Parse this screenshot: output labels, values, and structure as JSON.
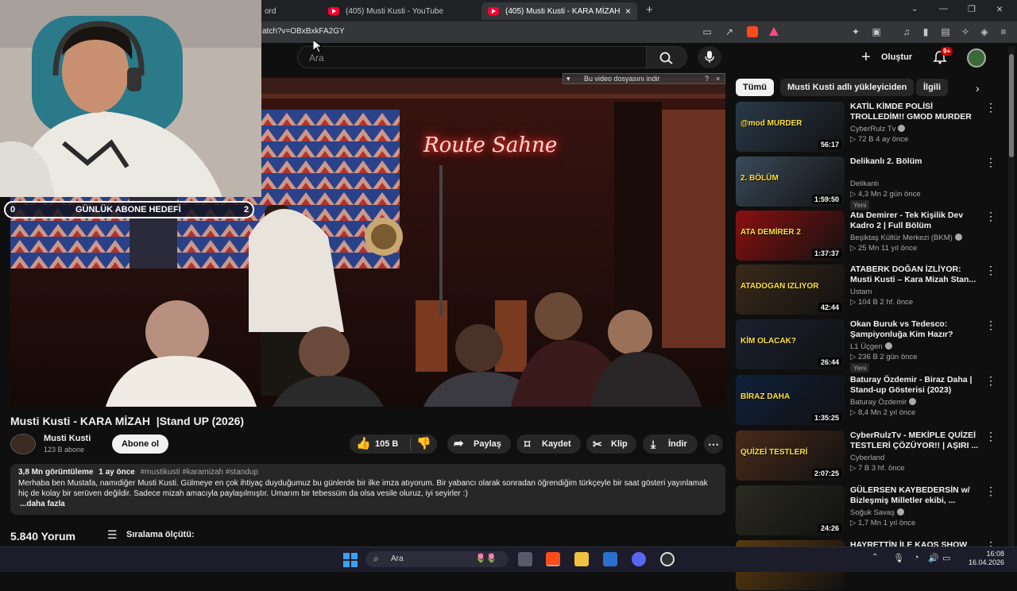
{
  "browser": {
    "tabs": [
      {
        "label": "ord"
      },
      {
        "label": "(405) Musti Kusti - YouTube"
      },
      {
        "label": "(405) Musti Kusti - KARA MİZAH"
      }
    ],
    "new_tab": "+",
    "url": "atch?v=OBxBxkFA2GY"
  },
  "header": {
    "search_placeholder": "Ara",
    "create_label": "Oluştur",
    "notif_count": "9+"
  },
  "download_banner": "Bu video dosyasını indir",
  "download_banner_q": "?",
  "download_banner_close": "×",
  "overlay": {
    "goal_label": "GÜNLÜK ABONE HEDEFİ",
    "goal_current": "0",
    "goal_target": "2"
  },
  "video": {
    "neon_sign": "Route Sahne",
    "title": "Musti Kusti - KARA MİZAH  |Stand UP (2026)",
    "channel": "Musti Kusti",
    "subscribers": "123 B abone",
    "subscribe_label": "Abone ol",
    "likes": "105 B",
    "share_label": "Paylaş",
    "save_label": "Kaydet",
    "clip_label": "Klip",
    "download_label": "İndir"
  },
  "description": {
    "views": "3,8 Mn görüntüleme",
    "date": "1 ay önce",
    "tags": "#mustikusti #karamizah #standup",
    "text": "Merhaba ben Mustafa, namıdiğer Musti Kusti. Gülmeye en çok ihtiyaç duyduğumuz bu günlerde bir ilke imza atıyorum. Bir yabancı olarak sonradan öğrendiğim türkçeyle bir saat gösteri yayınlamak hiç de kolay bir serüven değildir. Sadece mizah amacıyla paylaşılmıştır. Umarım bir tebessüm da olsa vesile oluruz, iyi seyirler :)",
    "more": "...daha fazla"
  },
  "comments": {
    "count": "5.840 Yorum",
    "sort_label": "Sıralama ölçütü:"
  },
  "chips": [
    {
      "label": "Tümü"
    },
    {
      "label": "Musti Kusti adlı yükleyiciden"
    },
    {
      "label": "İlgili"
    }
  ],
  "recommendations": [
    {
      "title": "KATİL KİMDE POLİSİ TROLLEDİM!! GMOD MURDER",
      "channel": "CyberRulz Tv",
      "verified": true,
      "meta": "72 B  4 ay önce",
      "duration": "56:17",
      "badge": "",
      "thumb_text": "@mod MURDER",
      "color": "#2a3a4a"
    },
    {
      "title": "Delikanlı 2. Bölüm",
      "channel": "Delikanlı",
      "verified": false,
      "meta": "4,3 Mn  2 gün önce",
      "duration": "1:59:50",
      "badge": "Yeni",
      "thumb_text": "2. BÖLÜM",
      "color": "#3a4a5a"
    },
    {
      "title": "Ata Demirer - Tek Kişilik Dev Kadro 2 | Full Bölüm",
      "channel": "Beşiktaş Kültür Merkezi (BKM)",
      "verified": true,
      "meta": "25 Mn  11 yıl önce",
      "duration": "1:37:37",
      "badge": "",
      "thumb_text": "ATA DEMİRER 2",
      "color": "#8a1010"
    },
    {
      "title": "ATABERK DOĞAN İZLİYOR: Musti Kusti – Kara Mizah Stan...",
      "channel": "Ustam",
      "verified": false,
      "meta": "104 B  2 hf. önce",
      "duration": "42:44",
      "badge": "",
      "thumb_text": "ATADOGAN IZLIYOR",
      "color": "#3a2a1a"
    },
    {
      "title": "Okan Buruk vs Tedesco: Şampiyonluğa Kim Hazır?",
      "channel": "L1 Üçgen",
      "verified": true,
      "meta": "236 B  2 gün önce",
      "duration": "26:44",
      "badge": "Yeni",
      "thumb_text": "KİM OLACAK?",
      "color": "#1a2030"
    },
    {
      "title": "Baturay Özdemir - Biraz Daha | Stand-up Gösterisi (2023)",
      "channel": "Baturay Özdemir",
      "verified": true,
      "meta": "8,4 Mn  2 yıl önce",
      "duration": "1:35:25",
      "badge": "",
      "thumb_text": "BİRAZ DAHA",
      "color": "#10203a"
    },
    {
      "title": "CyberRulzTv - MEKİPLE QUİZEİ TESTLERİ ÇÖZÜYOR!! | AŞIRI ...",
      "channel": "Cyberland",
      "verified": false,
      "meta": "7 B  3 hf. önce",
      "duration": "2:07:25",
      "badge": "",
      "thumb_text": "QUİZEİ TESTLERİ",
      "color": "#4a2a1a"
    },
    {
      "title": "GÜLERSEN KAYBEDERSİN w/ Bizleşmiş Milletler ekibi, ...",
      "channel": "Soğuk Savaş",
      "verified": true,
      "meta": "1,7 Mn  1 yıl önce",
      "duration": "24:26",
      "badge": "",
      "thumb_text": "",
      "color": "#2a2a20"
    },
    {
      "title": "HAYRETTİN İLE KAOS SHOW",
      "channel": "",
      "verified": false,
      "meta": "",
      "duration": "",
      "badge": "",
      "thumb_text": "",
      "color": "#5a3a10"
    }
  ],
  "taskbar": {
    "search_placeholder": "Ara",
    "time": "16:08",
    "date": "16.04.2026"
  }
}
